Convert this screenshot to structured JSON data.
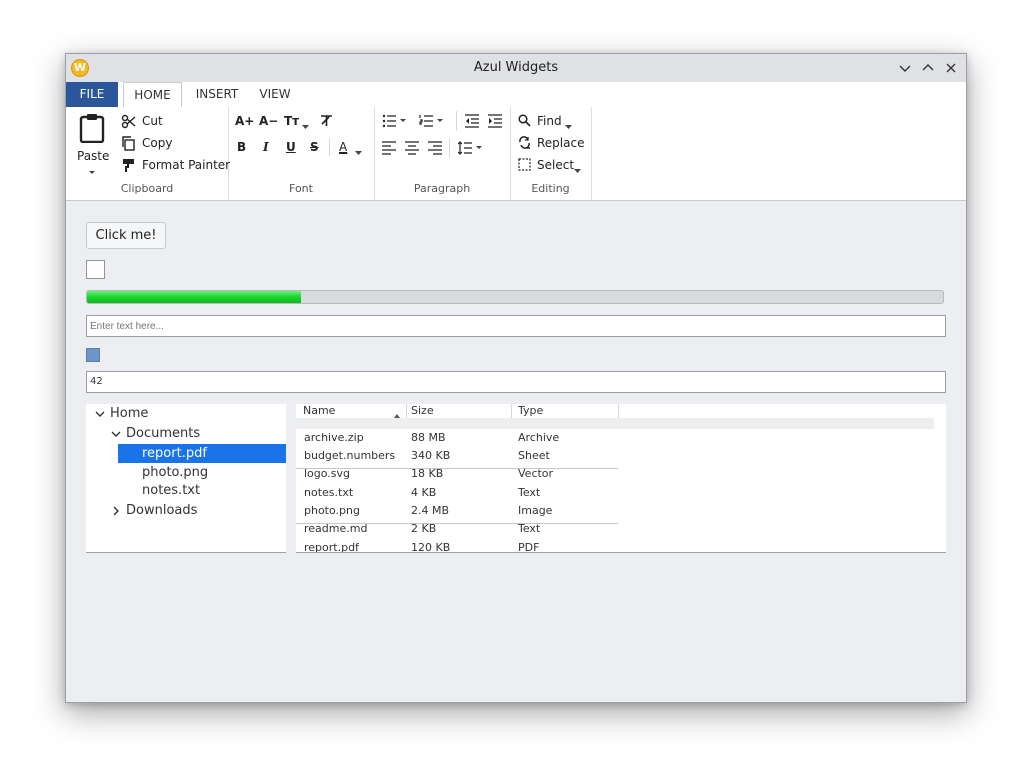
{
  "window": {
    "title": "Azul Widgets",
    "app_icon_letter": "W",
    "controls": [
      "minimize-icon",
      "maximize-icon",
      "close-icon"
    ]
  },
  "ribbon": {
    "tabs": [
      {
        "label": "FILE",
        "active": false
      },
      {
        "label": "HOME",
        "active": true
      },
      {
        "label": "INSERT",
        "active": false
      },
      {
        "label": "VIEW",
        "active": false
      }
    ],
    "groups": {
      "clipboard": {
        "label": "Clipboard",
        "paste": "Paste",
        "cut": "Cut",
        "copy": "Copy",
        "format_painter": "Format Painter"
      },
      "font": {
        "label": "Font",
        "grow": "A+",
        "shrink": "A−",
        "case": "Tт",
        "bold": "B",
        "italic": "I",
        "underline": "U",
        "strike": "S",
        "color": "A"
      },
      "paragraph": {
        "label": "Paragraph"
      },
      "editing": {
        "label": "Editing",
        "find": "Find",
        "replace": "Replace",
        "select": "Select"
      }
    }
  },
  "controls": {
    "button_label": "Click me!",
    "checkbox_checked": false,
    "progress_fraction": 0.25,
    "text_placeholder": "Enter text here...",
    "color_value": "#6d95c7",
    "number_value": "42"
  },
  "tree": {
    "items": [
      {
        "label": "Home",
        "expanded": true
      },
      {
        "label": "Documents",
        "expanded": true
      },
      {
        "label": "report.pdf",
        "selected": true
      },
      {
        "label": "photo.png"
      },
      {
        "label": "notes.txt"
      },
      {
        "label": "Downloads",
        "expanded": false
      }
    ]
  },
  "table": {
    "columns": [
      "Name",
      "Size",
      "Type"
    ],
    "sort_column": "Name",
    "rows": [
      {
        "name": "archive.zip",
        "size": "88 MB",
        "type": "Archive"
      },
      {
        "name": "budget.numbers",
        "size": "340 KB",
        "type": "Sheet"
      },
      {
        "name": "logo.svg",
        "size": "18 KB",
        "type": "Vector"
      },
      {
        "name": "notes.txt",
        "size": "4 KB",
        "type": "Text"
      },
      {
        "name": "photo.png",
        "size": "2.4 MB",
        "type": "Image"
      },
      {
        "name": "readme.md",
        "size": "2 KB",
        "type": "Text"
      },
      {
        "name": "report.pdf",
        "size": "120 KB",
        "type": "PDF"
      }
    ]
  },
  "colors": {
    "file_tab": "#2b579a",
    "selection": "#1a73e8",
    "progress": "#1ad52e"
  }
}
